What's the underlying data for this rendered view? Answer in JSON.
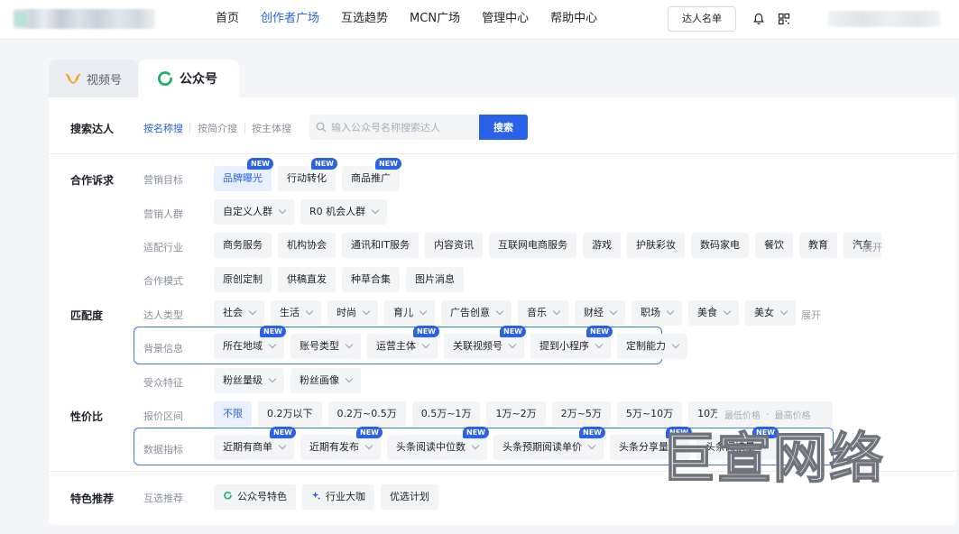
{
  "nav": {
    "items": [
      "首页",
      "创作者广场",
      "互选趋势",
      "MCN广场",
      "管理中心",
      "帮助中心"
    ],
    "active_index": 1,
    "talent_list_button": "达人名单"
  },
  "tabs": [
    {
      "label": "视频号"
    },
    {
      "label": "公众号"
    }
  ],
  "active_tab": 1,
  "search": {
    "section_label": "搜索达人",
    "modes": [
      "按名称搜",
      "按简介搜",
      "按主体搜"
    ],
    "active_mode": 0,
    "placeholder": "输入公众号名称搜索达人",
    "button": "搜索"
  },
  "sections": {
    "cooperation": "合作诉求",
    "match": "匹配度",
    "value": "性价比",
    "featured": "特色推荐"
  },
  "rows": {
    "marketing_goal": {
      "label": "营销目标",
      "chips": [
        {
          "label": "品牌曝光",
          "badge": "NEW",
          "active": true
        },
        {
          "label": "行动转化",
          "badge": "NEW"
        },
        {
          "label": "商品推广",
          "badge": "NEW"
        }
      ]
    },
    "marketing_audience": {
      "label": "营销人群",
      "chips": [
        {
          "label": "自定义人群",
          "dropdown": true
        },
        {
          "label": "R0 机会人群",
          "dropdown": true
        }
      ]
    },
    "industry": {
      "label": "适配行业",
      "chips": [
        {
          "label": "商务服务"
        },
        {
          "label": "机构协会"
        },
        {
          "label": "通讯和IT服务"
        },
        {
          "label": "内容资讯"
        },
        {
          "label": "互联网电商服务"
        },
        {
          "label": "游戏"
        },
        {
          "label": "护肤彩妆"
        },
        {
          "label": "数码家电"
        },
        {
          "label": "餐饮"
        },
        {
          "label": "教育"
        },
        {
          "label": "汽车"
        }
      ],
      "expand": "展开"
    },
    "coop_mode": {
      "label": "合作模式",
      "chips": [
        {
          "label": "原创定制"
        },
        {
          "label": "供稿直发"
        },
        {
          "label": "种草合集"
        },
        {
          "label": "图片消息"
        }
      ]
    },
    "talent_type": {
      "label": "达人类型",
      "chips": [
        {
          "label": "社会",
          "dropdown": true
        },
        {
          "label": "生活",
          "dropdown": true
        },
        {
          "label": "时尚",
          "dropdown": true
        },
        {
          "label": "育儿",
          "dropdown": true
        },
        {
          "label": "广告创意",
          "dropdown": true
        },
        {
          "label": "音乐",
          "dropdown": true
        },
        {
          "label": "财经",
          "dropdown": true
        },
        {
          "label": "职场",
          "dropdown": true
        },
        {
          "label": "美食",
          "dropdown": true
        },
        {
          "label": "美女",
          "dropdown": true
        }
      ],
      "expand": "展开"
    },
    "background": {
      "label": "背景信息",
      "chips": [
        {
          "label": "所在地域",
          "badge": "NEW",
          "dropdown": true
        },
        {
          "label": "账号类型",
          "dropdown": true
        },
        {
          "label": "运营主体",
          "badge": "NEW",
          "dropdown": true
        },
        {
          "label": "关联视频号",
          "badge": "NEW",
          "dropdown": true
        },
        {
          "label": "提到小程序",
          "badge": "NEW",
          "dropdown": true
        },
        {
          "label": "定制能力",
          "dropdown": true
        }
      ]
    },
    "audience_traits": {
      "label": "受众特征",
      "chips": [
        {
          "label": "粉丝量级",
          "dropdown": true
        },
        {
          "label": "粉丝画像",
          "dropdown": true
        }
      ]
    },
    "price_range": {
      "label": "报价区间",
      "chips": [
        {
          "label": "不限",
          "active": true
        },
        {
          "label": "0.2万以下"
        },
        {
          "label": "0.2万~0.5万"
        },
        {
          "label": "0.5万~1万"
        },
        {
          "label": "1万~2万"
        },
        {
          "label": "2万~5万"
        },
        {
          "label": "5万~10万"
        },
        {
          "label": "10万以上"
        }
      ],
      "min_placeholder": "最低价格",
      "max_placeholder": "最高价格"
    },
    "data_metrics": {
      "label": "数据指标",
      "chips": [
        {
          "label": "近期有商单",
          "badge": "NEW",
          "dropdown": true
        },
        {
          "label": "近期有发布",
          "badge": "NEW",
          "dropdown": true
        },
        {
          "label": "头条阅读中位数",
          "badge": "NEW",
          "dropdown": true
        },
        {
          "label": "头条预期阅读单价",
          "badge": "NEW",
          "dropdown": true
        },
        {
          "label": "头条分享量",
          "badge": "NEW",
          "dropdown": true
        },
        {
          "label": "头条阅读量",
          "badge": "NEW",
          "dropdown": true
        }
      ]
    },
    "mutual_pick": {
      "label": "互选推荐",
      "chips": [
        {
          "label": "公众号特色",
          "icon": "wechat-oa-icon"
        },
        {
          "label": "行业大咖",
          "icon": "sparkle-icon"
        },
        {
          "label": "优选计划"
        }
      ]
    }
  },
  "watermark": "巨宣网络",
  "colors": {
    "accent": "#2962e8",
    "highlight_border": "#3a7be0",
    "badge": "#2962e8"
  }
}
